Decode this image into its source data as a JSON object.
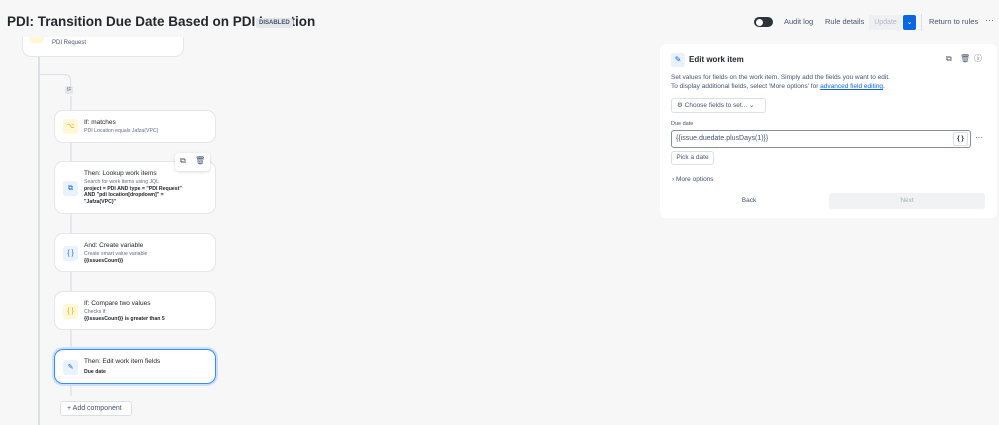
{
  "header": {
    "title": "PDI: Transition Due Date Based on PDI Location",
    "status_badge": "DISABLED",
    "audit_log": "Audit log",
    "rule_details": "Rule details",
    "update": "Update",
    "return": "Return to rules",
    "more": "···"
  },
  "canvas": {
    "trigger_subtitle": "PDI Request",
    "if_badge": "IF",
    "cards": [
      {
        "title": "If: matches",
        "subtitle": "PDI Location equals Jafza(VPC)"
      },
      {
        "title": "Then: Lookup work items",
        "subtitle": "Search for work items using JQL",
        "detail": [
          "project = PDI AND type = \"PDI Request\"",
          "AND \"pdi location[dropdown]\" =",
          "\"Jafza(VPC)\""
        ]
      },
      {
        "title": "And: Create variable",
        "subtitle": "Create smart value variable",
        "detail": "{{issuesCount}}"
      },
      {
        "title": "If: Compare two values",
        "subtitle": "Checks if:",
        "detail": "{{issuesCount}} is greater than 5"
      },
      {
        "title": "Then: Edit work item fields",
        "detail": "Due date"
      }
    ],
    "add_component": "Add component"
  },
  "panel": {
    "title": "Edit work item",
    "desc1": "Set values for fields on the work item. Simply add the fields you want to edit.",
    "desc2": "To display additional fields, select 'More options' for ",
    "link": "advanced field editing",
    "desc_end": ".",
    "choose_fields": "Choose fields to set...",
    "field_label": "Due date",
    "field_value": "{{issue.duedate.plusDays(1)}}",
    "smart_btn": "{ }",
    "field_more": "···",
    "pick_date": "Pick a date",
    "more_options": "More options",
    "back": "Back",
    "next": "Next"
  }
}
